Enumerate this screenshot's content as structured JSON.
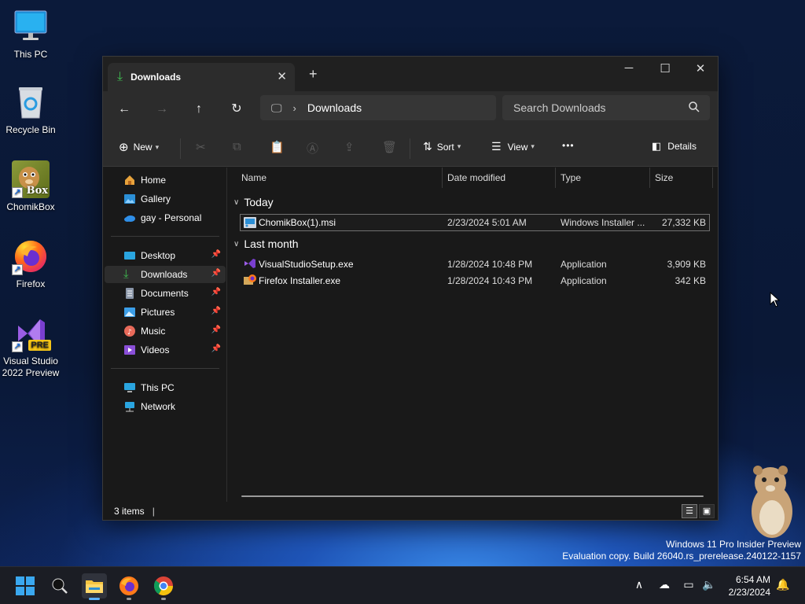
{
  "desktop": {
    "icons": [
      {
        "label": "This PC",
        "icon": "monitor-icon"
      },
      {
        "label": "Recycle Bin",
        "icon": "recycle-bin-icon"
      },
      {
        "label": "ChomikBox",
        "icon": "chomikbox-app-icon"
      },
      {
        "label": "Firefox",
        "icon": "firefox-icon"
      },
      {
        "label": "Visual Studio 2022 Preview",
        "icon": "visual-studio-preview-icon"
      }
    ],
    "chomikbox_logo_text": "Box",
    "vs_badge": "PRE"
  },
  "window": {
    "tab_title": "Downloads",
    "new_tab": "+",
    "address_location": "Downloads",
    "search_placeholder": "Search Downloads",
    "commands": {
      "new_label": "New",
      "sort_label": "Sort",
      "view_label": "View",
      "more_label": "•••",
      "details_label": "Details"
    },
    "sidebar": {
      "top": [
        {
          "label": "Home",
          "icon": "home-icon"
        },
        {
          "label": "Gallery",
          "icon": "gallery-icon"
        },
        {
          "label": "gay - Personal",
          "icon": "onedrive-cloud-icon"
        }
      ],
      "quick_access": [
        {
          "label": "Desktop",
          "icon": "desktop-folder-icon",
          "pinned": true
        },
        {
          "label": "Downloads",
          "icon": "downloads-folder-icon",
          "pinned": true,
          "selected": true
        },
        {
          "label": "Documents",
          "icon": "documents-folder-icon",
          "pinned": true
        },
        {
          "label": "Pictures",
          "icon": "pictures-folder-icon",
          "pinned": true
        },
        {
          "label": "Music",
          "icon": "music-folder-icon",
          "pinned": true
        },
        {
          "label": "Videos",
          "icon": "videos-folder-icon",
          "pinned": true
        }
      ],
      "bottom": [
        {
          "label": "This PC",
          "icon": "this-pc-icon"
        },
        {
          "label": "Network",
          "icon": "network-icon"
        }
      ]
    },
    "columns": {
      "name": "Name",
      "date": "Date modified",
      "type": "Type",
      "size": "Size"
    },
    "groups": [
      {
        "label": "Today",
        "files": [
          {
            "name": "ChomikBox(1).msi",
            "date": "2/23/2024 5:01 AM",
            "type": "Windows Installer ...",
            "size": "27,332 KB",
            "icon": "msi-installer-icon",
            "selected": true
          }
        ]
      },
      {
        "label": "Last month",
        "files": [
          {
            "name": "VisualStudioSetup.exe",
            "date": "1/28/2024 10:48 PM",
            "type": "Application",
            "size": "3,909 KB",
            "icon": "visual-studio-icon"
          },
          {
            "name": "Firefox Installer.exe",
            "date": "1/28/2024 10:43 PM",
            "type": "Application",
            "size": "342 KB",
            "icon": "firefox-installer-icon"
          }
        ]
      }
    ],
    "status_text": "3 items"
  },
  "watermark": {
    "line1": "Windows 11 Pro Insider Preview",
    "line2": "Evaluation copy. Build 26040.rs_prerelease.240122-1157"
  },
  "taskbar": {
    "time": "6:54 AM",
    "date": "2/23/2024",
    "apps": [
      "start-icon",
      "search-icon",
      "file-explorer-icon",
      "firefox-icon",
      "chrome-icon"
    ]
  },
  "colors": {
    "accent": "#4cc2ff",
    "downloads_green": "#3fb950",
    "window_bg": "#191919"
  }
}
